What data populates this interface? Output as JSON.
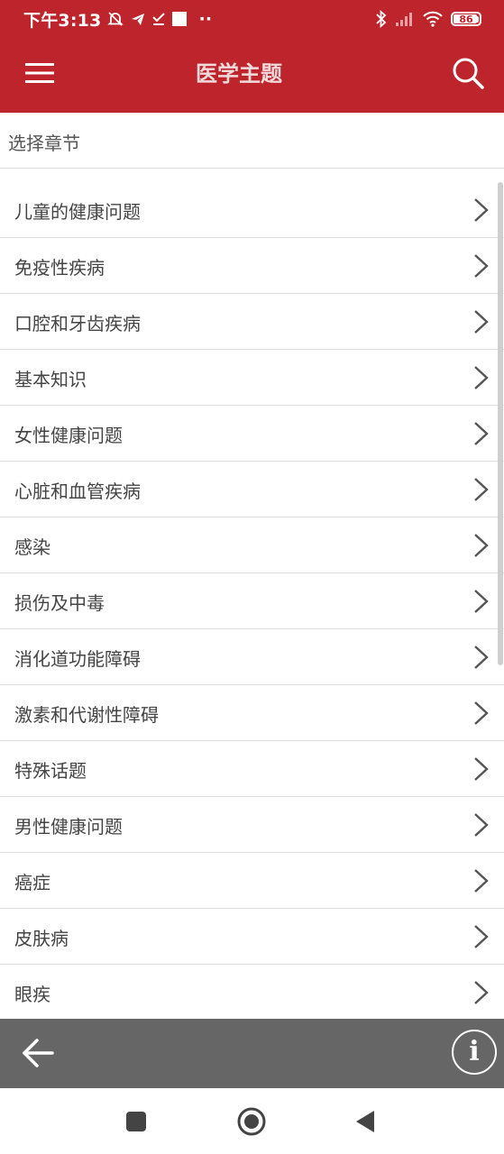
{
  "status_bar": {
    "time": "下午3:13",
    "overflow": "··",
    "battery": "86"
  },
  "app_bar": {
    "title": "医学主题"
  },
  "section": {
    "title": "选择章节"
  },
  "topics": [
    {
      "label": "儿童的健康问题"
    },
    {
      "label": "免疫性疾病"
    },
    {
      "label": "口腔和牙齿疾病"
    },
    {
      "label": "基本知识"
    },
    {
      "label": "女性健康问题"
    },
    {
      "label": "心脏和血管疾病"
    },
    {
      "label": "感染"
    },
    {
      "label": "损伤及中毒"
    },
    {
      "label": "消化道功能障碍"
    },
    {
      "label": "激素和代谢性障碍"
    },
    {
      "label": "特殊话题"
    },
    {
      "label": "男性健康问题"
    },
    {
      "label": "癌症"
    },
    {
      "label": "皮肤病"
    },
    {
      "label": "眼疾"
    }
  ],
  "toolbar": {
    "info_label": "i"
  },
  "icons": {
    "menu": "menu-icon",
    "search": "search-icon",
    "chevron": "chevron-right-icon",
    "back": "arrow-left-icon",
    "info": "info-icon"
  },
  "colors": {
    "brand": "#be242c",
    "toolbar": "#666666"
  }
}
